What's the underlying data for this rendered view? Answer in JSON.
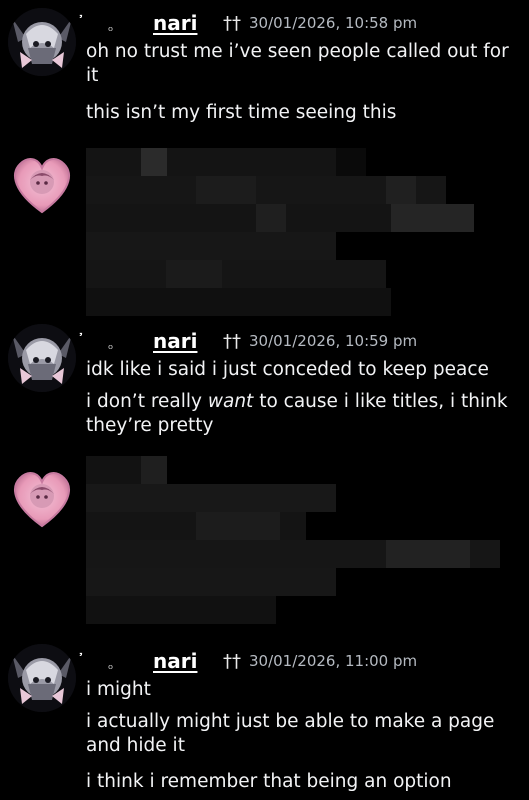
{
  "messages": [
    {
      "author": "nari",
      "deco_left": "҆",
      "deco_right": "ₒ",
      "cross": "††",
      "timestamp": "30/01/2026, 10:58 pm",
      "lines": [
        "oh no trust me i’ve seen people called out for it",
        "this isn’t my first time seeing this"
      ]
    },
    {
      "author": "nari",
      "deco_left": "҆",
      "deco_right": "ₒ",
      "cross": "††",
      "timestamp": "30/01/2026, 10:59 pm",
      "lines": [
        "idk like i said i just conceded to keep peace",
        {
          "before": "i don’t really ",
          "emphasis": "want",
          "after": " to cause i like titles, i think they’re pretty"
        }
      ]
    },
    {
      "author": "nari",
      "deco_left": "҆",
      "deco_right": "ₒ",
      "cross": "††",
      "timestamp": "30/01/2026, 11:00 pm",
      "lines": [
        "i might",
        "i actually might just be able to make a page and hide it",
        "i think i remember that being an option"
      ]
    }
  ],
  "redacted_blocks": [
    {
      "note": "pixelated message"
    },
    {
      "note": "pixelated message"
    }
  ],
  "colors": {
    "background": "#000000",
    "text": "#f2f3f5",
    "timestamp": "#b5bac1",
    "heart_pink": "#e89ab8"
  }
}
